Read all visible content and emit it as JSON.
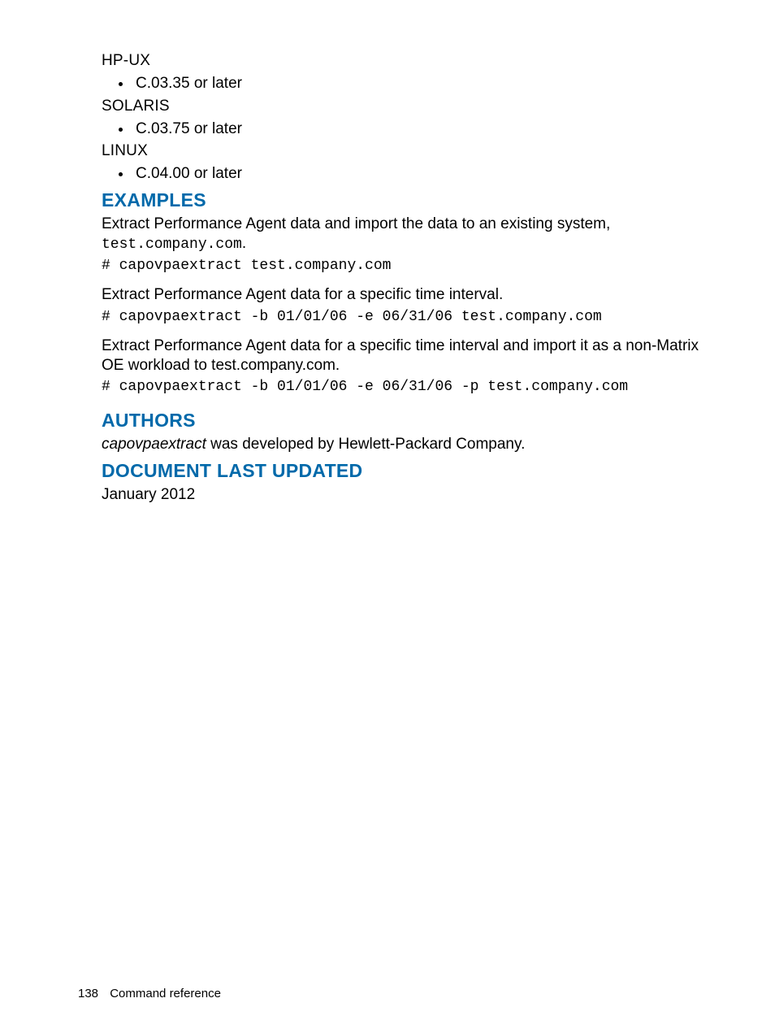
{
  "platforms": [
    {
      "os": "HP-UX",
      "version": "C.03.35 or later"
    },
    {
      "os": "SOLARIS",
      "version": "C.03.75 or later"
    },
    {
      "os": "LINUX",
      "version": "C.04.00 or later"
    }
  ],
  "sections": {
    "examples_heading": "EXAMPLES",
    "authors_heading": "AUTHORS",
    "updated_heading": "DOCUMENT LAST UPDATED"
  },
  "examples": {
    "ex1_intro_a": "Extract Performance Agent data and import the data to an existing system, ",
    "ex1_intro_code": "test.company.com",
    "ex1_intro_b": ".",
    "ex1_cmd": "# capovpaextract test.company.com",
    "ex2_intro": "Extract Performance Agent data for a specific time interval.",
    "ex2_cmd": "# capovpaextract -b 01/01/06 -e 06/31/06 test.company.com",
    "ex3_intro": "Extract Performance Agent data for a specific time interval and import it as a non-Matrix OE workload to test.company.com.",
    "ex3_cmd": "# capovpaextract -b 01/01/06 -e 06/31/06 -p test.company.com"
  },
  "authors": {
    "tool": "capovpaextract",
    "rest": " was developed by Hewlett-Packard Company."
  },
  "updated": "January 2012",
  "footer": {
    "page_number": "138",
    "section": "Command reference"
  }
}
